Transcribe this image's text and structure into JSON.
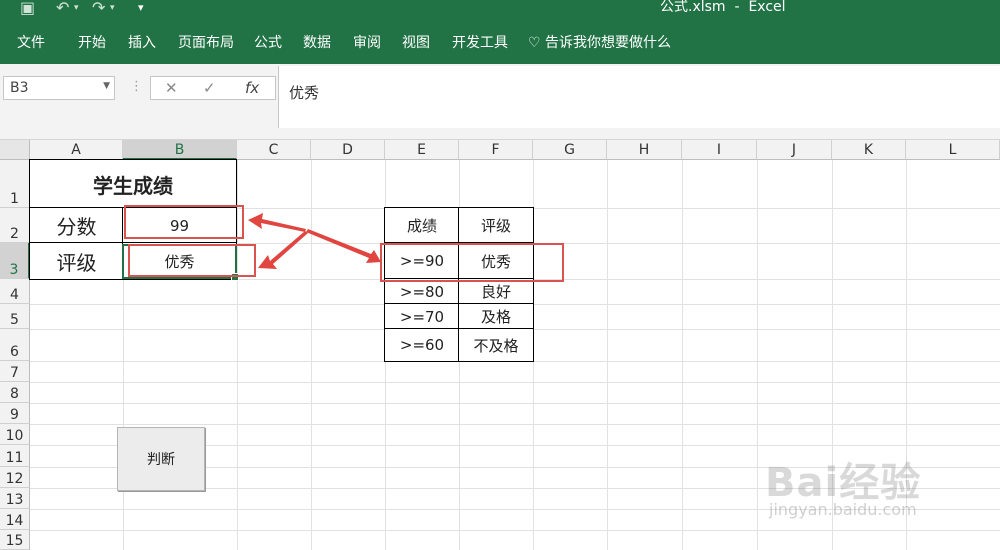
{
  "titlebar": {
    "filename": "公式.xlsm",
    "sep": "-",
    "app": "Excel"
  },
  "ribbon": {
    "tabs": [
      "文件",
      "开始",
      "插入",
      "页面布局",
      "公式",
      "数据",
      "审阅",
      "视图",
      "开发工具"
    ],
    "tellme": "告诉我你想要做什么"
  },
  "formula_bar": {
    "name_box": "B3",
    "fx": "fx",
    "value": "优秀"
  },
  "columns": [
    "A",
    "B",
    "C",
    "D",
    "E",
    "F",
    "G",
    "H",
    "I",
    "J",
    "K",
    "L"
  ],
  "rows": [
    "1",
    "2",
    "3",
    "4",
    "5",
    "6",
    "7",
    "8",
    "9",
    "10",
    "11",
    "12",
    "13",
    "14",
    "15"
  ],
  "sheet": {
    "title": "学生成绩",
    "score_label": "分数",
    "score_value": "99",
    "grade_label": "评级",
    "grade_value": "优秀"
  },
  "lookup": {
    "headers": [
      "成绩",
      "评级"
    ],
    "rows": [
      [
        ">=90",
        "优秀"
      ],
      [
        ">=80",
        "良好"
      ],
      [
        ">=70",
        "及格"
      ],
      [
        ">=60",
        "不及格"
      ]
    ]
  },
  "button": {
    "label": "判断"
  },
  "watermark": {
    "brand": "Bai经验",
    "url": "jingyan.baidu.com"
  },
  "colors": {
    "accent": "#217346",
    "annotation": "#d9534f"
  }
}
